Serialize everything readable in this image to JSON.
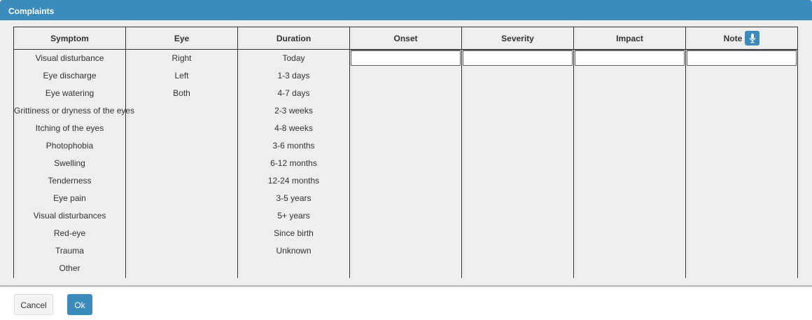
{
  "dialog": {
    "title": "Complaints"
  },
  "columns": {
    "symptom": "Symptom",
    "eye": "Eye",
    "duration": "Duration",
    "onset": "Onset",
    "severity": "Severity",
    "impact": "Impact",
    "note": "Note"
  },
  "symptoms": [
    "Visual disturbance",
    "Eye discharge",
    "Eye watering",
    "Grittiness or dryness of the eyes",
    "Itching of the eyes",
    "Photophobia",
    "Swelling",
    "Tenderness",
    "Eye pain",
    "Visual disturbances",
    "Red-eye",
    "Trauma",
    "Other"
  ],
  "eyes": [
    "Right",
    "Left",
    "Both"
  ],
  "durations": [
    "Today",
    "1-3 days",
    "4-7 days",
    "2-3 weeks",
    "4-8 weeks",
    "3-6 months",
    "6-12 months",
    "12-24 months",
    "3-5 years",
    "5+ years",
    "Since birth",
    "Unknown"
  ],
  "inputs": {
    "onset": "",
    "severity": "",
    "impact": "",
    "note": ""
  },
  "footer": {
    "cancel": "Cancel",
    "ok": "Ok"
  },
  "colors": {
    "accent": "#3b8bbd"
  }
}
